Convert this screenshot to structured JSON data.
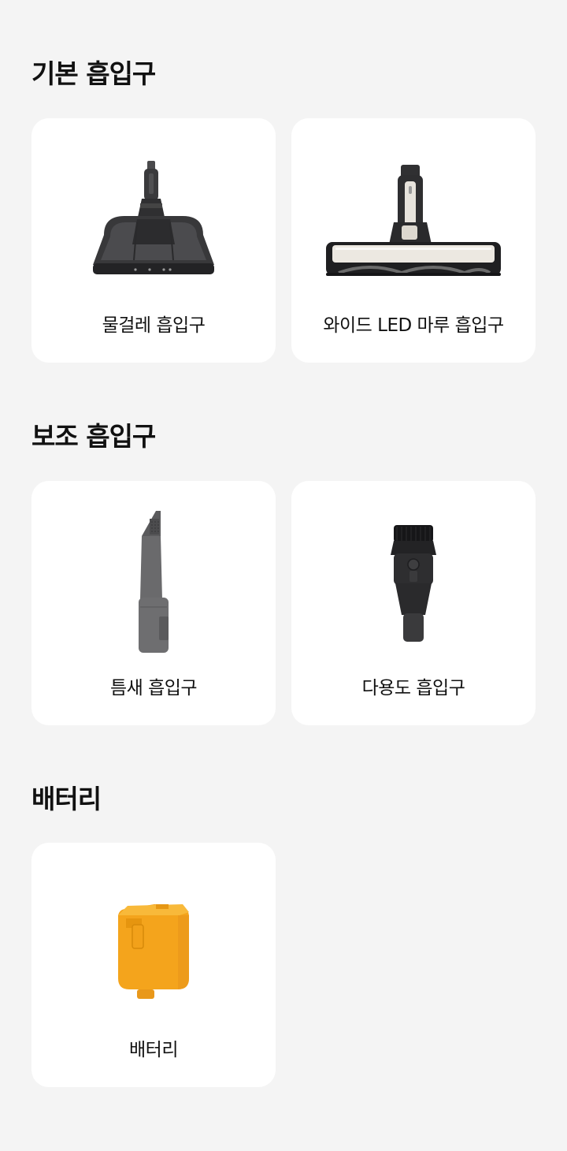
{
  "sections": [
    {
      "title": "기본 흡입구",
      "items": [
        {
          "label": "물걸레 흡입구",
          "icon": "mop-nozzle-icon"
        },
        {
          "label": "와이드 LED 마루 흡입구",
          "icon": "wide-led-floor-nozzle-icon"
        }
      ]
    },
    {
      "title": "보조 흡입구",
      "items": [
        {
          "label": "틈새 흡입구",
          "icon": "crevice-nozzle-icon"
        },
        {
          "label": "다용도 흡입구",
          "icon": "multipurpose-nozzle-icon"
        }
      ]
    },
    {
      "title": "배터리",
      "items": [
        {
          "label": "배터리",
          "icon": "battery-icon"
        }
      ]
    }
  ],
  "colors": {
    "background": "#f4f4f4",
    "card": "#ffffff",
    "battery": "#f7a81d",
    "dark_gray": "#3d3d3f",
    "mid_gray": "#6b6b6b"
  }
}
